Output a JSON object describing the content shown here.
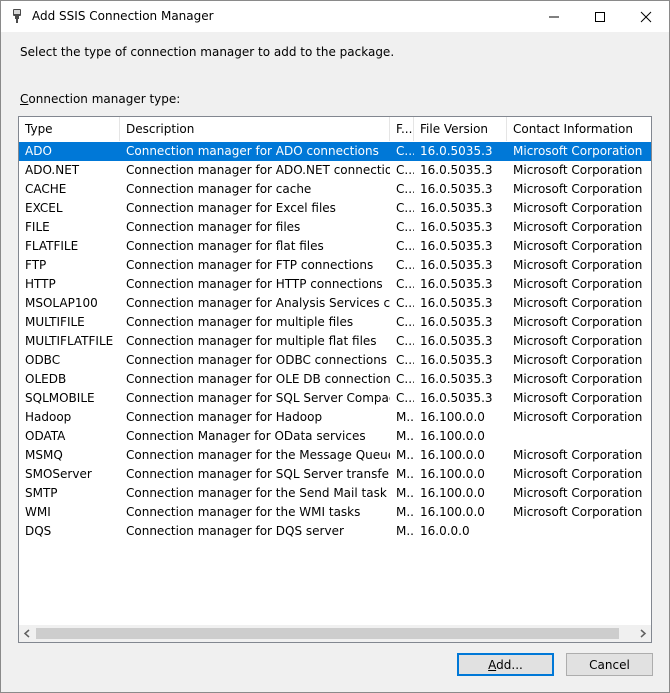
{
  "window": {
    "title": "Add SSIS Connection Manager"
  },
  "instruction": "Select the type of connection manager to add to the package.",
  "list_label": {
    "accel": "C",
    "rest": "onnection manager type:"
  },
  "columns": [
    "Type",
    "Description",
    "F...",
    "File Version",
    "Contact Information"
  ],
  "rows": [
    [
      "ADO",
      "Connection manager for ADO connections",
      "C...",
      "16.0.5035.3",
      "Microsoft Corporation"
    ],
    [
      "ADO.NET",
      "Connection manager for ADO.NET connections",
      "C...",
      "16.0.5035.3",
      "Microsoft Corporation"
    ],
    [
      "CACHE",
      "Connection manager for cache",
      "C...",
      "16.0.5035.3",
      "Microsoft Corporation"
    ],
    [
      "EXCEL",
      "Connection manager for Excel files",
      "C...",
      "16.0.5035.3",
      "Microsoft Corporation"
    ],
    [
      "FILE",
      "Connection manager for files",
      "C...",
      "16.0.5035.3",
      "Microsoft Corporation"
    ],
    [
      "FLATFILE",
      "Connection manager for flat files",
      "C...",
      "16.0.5035.3",
      "Microsoft Corporation"
    ],
    [
      "FTP",
      "Connection manager for FTP connections",
      "C...",
      "16.0.5035.3",
      "Microsoft Corporation"
    ],
    [
      "HTTP",
      "Connection manager for HTTP connections",
      "C...",
      "16.0.5035.3",
      "Microsoft Corporation"
    ],
    [
      "MSOLAP100",
      "Connection manager for Analysis Services con...",
      "C...",
      "16.0.5035.3",
      "Microsoft Corporation"
    ],
    [
      "MULTIFILE",
      "Connection manager for multiple files",
      "C...",
      "16.0.5035.3",
      "Microsoft Corporation"
    ],
    [
      "MULTIFLATFILE",
      "Connection manager for multiple flat files",
      "C...",
      "16.0.5035.3",
      "Microsoft Corporation"
    ],
    [
      "ODBC",
      "Connection manager for ODBC connections",
      "C...",
      "16.0.5035.3",
      "Microsoft Corporation"
    ],
    [
      "OLEDB",
      "Connection manager for OLE DB connections",
      "C...",
      "16.0.5035.3",
      "Microsoft Corporation"
    ],
    [
      "SQLMOBILE",
      "Connection manager for SQL Server Compact ...",
      "C...",
      "16.0.5035.3",
      "Microsoft Corporation"
    ],
    [
      "Hadoop",
      "Connection manager for Hadoop",
      "M...",
      "16.100.0.0",
      "Microsoft Corporation"
    ],
    [
      "ODATA",
      "Connection Manager for OData services",
      "M...",
      "16.100.0.0",
      ""
    ],
    [
      "MSMQ",
      "Connection manager for the Message Queue t...",
      "M...",
      "16.100.0.0",
      "Microsoft Corporation"
    ],
    [
      "SMOServer",
      "Connection manager for SQL Server transfer ta...",
      "M...",
      "16.100.0.0",
      "Microsoft Corporation"
    ],
    [
      "SMTP",
      "Connection manager for the Send Mail task",
      "M...",
      "16.100.0.0",
      "Microsoft Corporation"
    ],
    [
      "WMI",
      "Connection manager for the WMI tasks",
      "M...",
      "16.100.0.0",
      "Microsoft Corporation"
    ],
    [
      "DQS",
      "Connection manager for DQS server",
      "M...",
      "16.0.0.0",
      ""
    ]
  ],
  "selected_row": 0,
  "buttons": {
    "add": {
      "accel": "A",
      "rest": "dd..."
    },
    "cancel": "Cancel"
  },
  "icons": {
    "app": "ssis-plug-icon",
    "minimize": "minimize-icon",
    "maximize": "maximize-icon",
    "close": "close-icon",
    "scroll_left": "scroll-left-arrow-icon",
    "scroll_right": "scroll-right-arrow-icon"
  },
  "colors": {
    "selection": "#0078d7",
    "default_button_border": "#0078d7"
  }
}
